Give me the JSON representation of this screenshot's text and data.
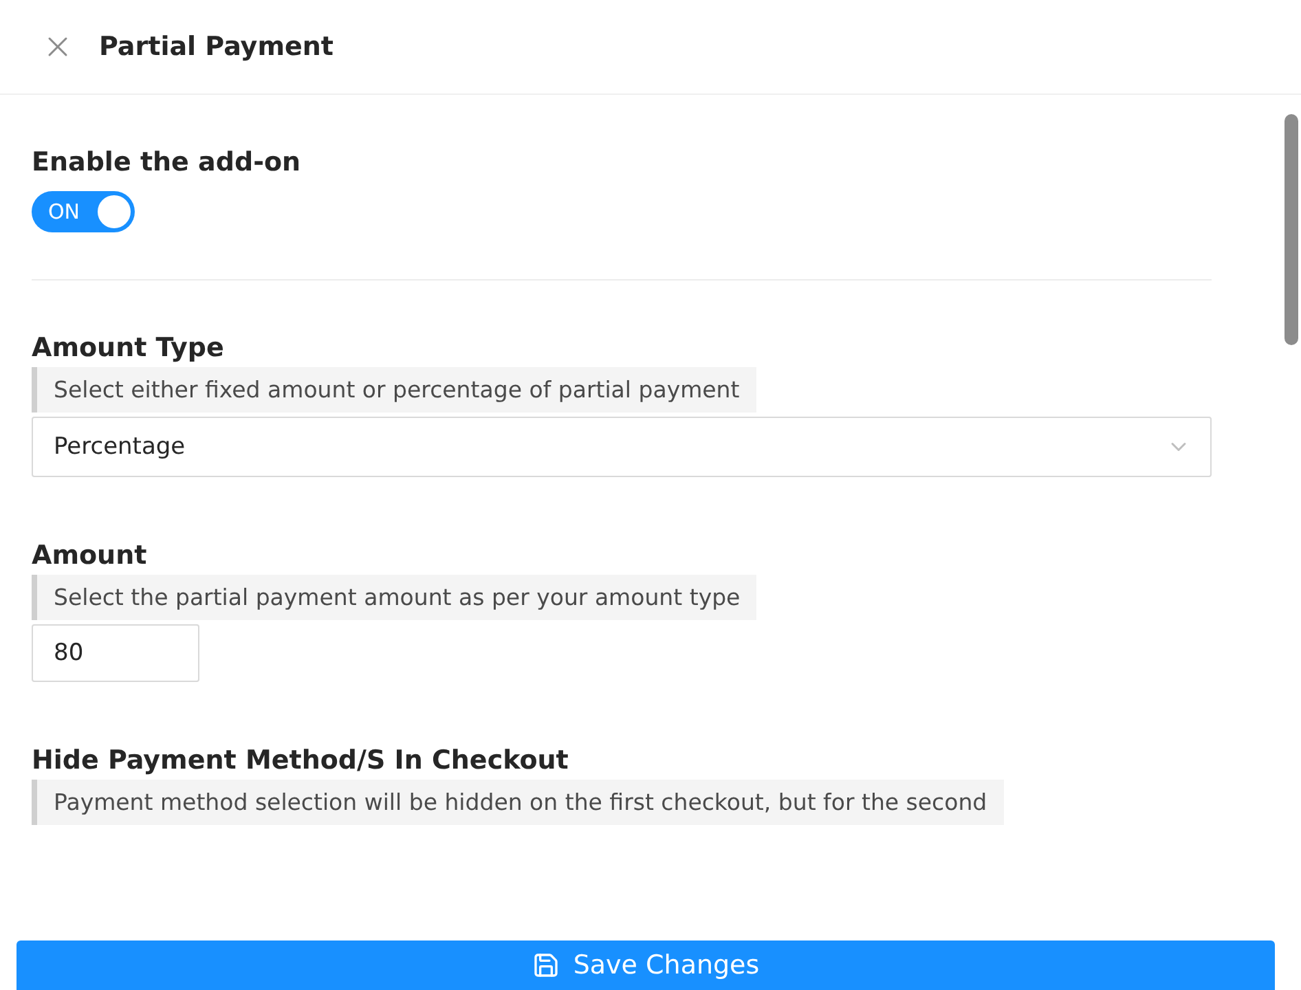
{
  "header": {
    "title": "Partial Payment"
  },
  "sections": [
    {
      "kind": "toggle",
      "title": "Enable the add-on",
      "on": true,
      "label": "ON"
    },
    {
      "kind": "select",
      "title": "Amount Type",
      "hint": "Select either fixed amount or percentage of partial payment",
      "value": "Percentage"
    },
    {
      "kind": "input",
      "title": "Amount",
      "hint": "Select the partial payment amount as per your amount type",
      "value": "80"
    },
    {
      "kind": "hint",
      "title": "Hide Payment Method/S In Checkout",
      "hint": "Payment method selection will be hidden on the first checkout, but for the second"
    }
  ],
  "save_button": "Save Changes"
}
